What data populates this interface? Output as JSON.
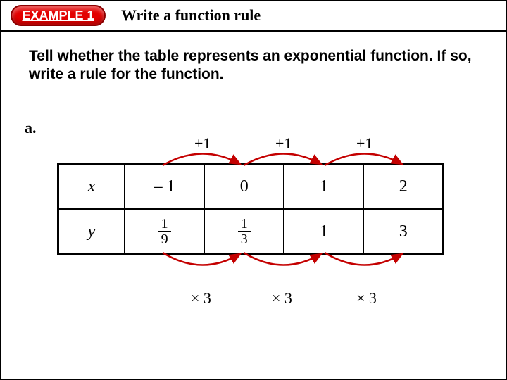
{
  "header": {
    "badge": "EXAMPLE 1",
    "title": "Write a function rule"
  },
  "prompt": "Tell whether the table represents an exponential function. If so, write a rule for the function.",
  "part_label": "a.",
  "table": {
    "x_sym": "x",
    "y_sym": "y",
    "x": [
      "– 1",
      "0",
      "1",
      "2"
    ],
    "y_frac": [
      {
        "num": "1",
        "den": "9"
      },
      {
        "num": "1",
        "den": "3"
      }
    ],
    "y_plain": [
      "1",
      "3"
    ]
  },
  "top_steps": [
    "+1",
    "+1",
    "+1"
  ],
  "bottom_steps": [
    "× 3",
    "× 3",
    "× 3"
  ],
  "colors": {
    "badge_red": "#e30000",
    "arrow_red": "#c40000"
  }
}
